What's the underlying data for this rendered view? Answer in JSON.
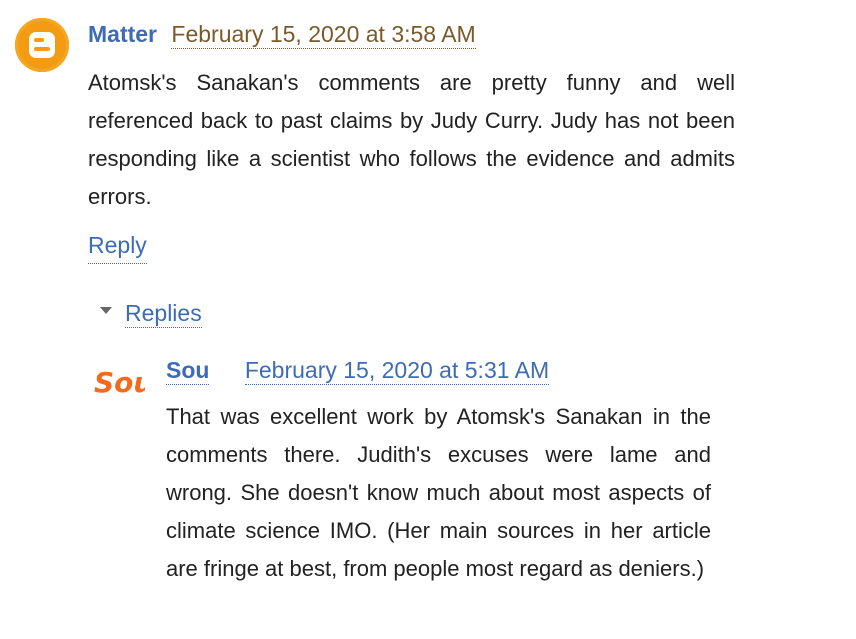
{
  "comment": {
    "author": "Matter",
    "timestamp": "February 15, 2020 at 3:58 AM",
    "body": "Atomsk's Sanakan's comments are pretty funny and well referenced back to past claims by Judy Curry. Judy has not been responding like a scientist who follows the evidence and admits errors.",
    "avatar_icon": "blogger-icon",
    "reply_label": "Reply"
  },
  "replies": {
    "toggle_label": "Replies",
    "items": [
      {
        "author": "Sou",
        "avatar_text": "Sou",
        "timestamp": "February 15, 2020 at 5:31 AM",
        "body": "That was excellent work by Atomsk's Sanakan in the comments there. Judith's excuses were lame and wrong. She doesn't know much about most aspects of climate science IMO. (Her main sources in her article are fringe at best, from people most regard as deniers.)"
      }
    ]
  },
  "colors": {
    "link": "#3d6cb5",
    "timestamp_main": "#7a5a2a",
    "blogger_orange": "#f39c12",
    "sou_orange": "#f26b1d",
    "text": "#222222"
  }
}
